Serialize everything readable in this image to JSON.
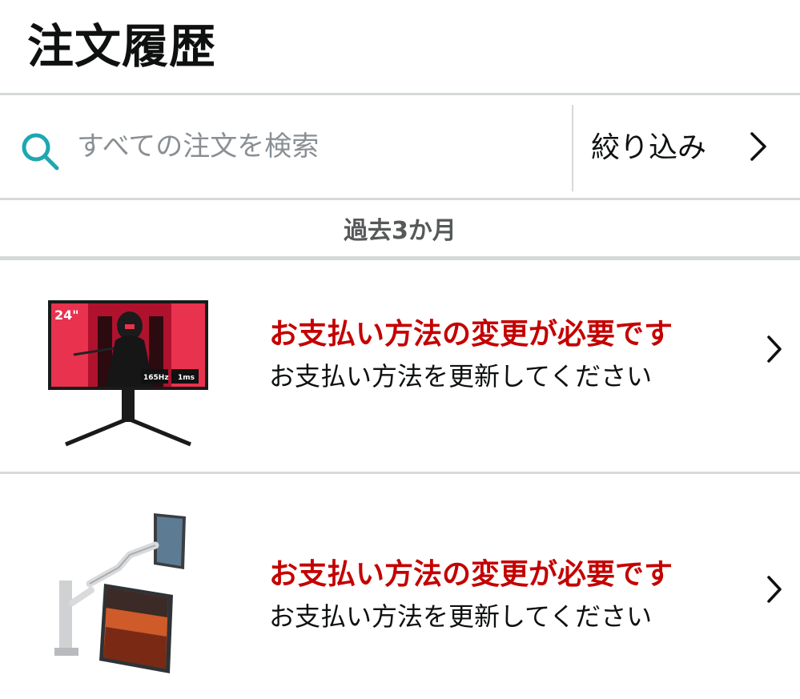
{
  "header": {
    "title": "注文履歴"
  },
  "search": {
    "placeholder": "すべての注文を検索"
  },
  "filter": {
    "label": "絞り込み"
  },
  "period": {
    "label": "過去3か月"
  },
  "orders": [
    {
      "status": "お支払い方法の変更が必要です",
      "subtext": "お支払い方法を更新してください",
      "image_badges": [
        "24\"",
        "165Hz",
        "1ms"
      ]
    },
    {
      "status": "お支払い方法の変更が必要です",
      "subtext": "お支払い方法を更新してください"
    }
  ],
  "colors": {
    "accent_teal": "#1da7b2",
    "alert_red": "#c40000",
    "divider": "#d5d9d9",
    "muted_text": "#565959"
  }
}
